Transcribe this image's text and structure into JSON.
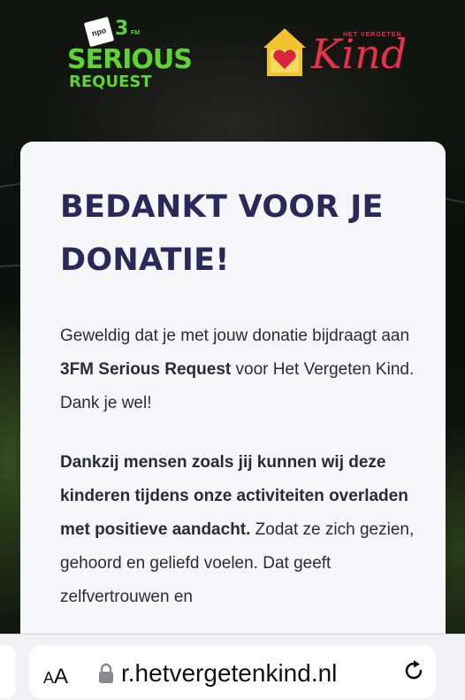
{
  "logos": {
    "npo": "npo",
    "three_fm_number": "3",
    "three_fm_suffix": "FM",
    "serious": "SERIOUS",
    "request": "REQUEST",
    "hvk_small": "HET VERGETEN",
    "hvk_kind": "Kind"
  },
  "card": {
    "title": "BEDANKT VOOR JE DONATIE!",
    "p1_part1": "Geweldig dat je met jouw donatie bijdraagt aan ",
    "p1_bold": "3FM Serious Request",
    "p1_part2": " voor Het Vergeten Kind. Dank je wel!",
    "p2_bold": "Dankzij mensen zoals jij kunnen wij deze kinderen tijdens onze activiteiten overladen met positieve aandacht.",
    "p2_rest": " Zodat ze zich gezien, gehoord en geliefd voelen. Dat geeft zelfvertrouwen en"
  },
  "browser": {
    "aa_label_small": "A",
    "aa_label_large": "A",
    "url": "r.hetvergetenkind.nl",
    "icons": [
      "lock-icon",
      "reload-icon"
    ]
  },
  "colors": {
    "title": "#2a2a5a",
    "serious_request_green": "#5ed432",
    "hvk_red": "#e8324b"
  }
}
